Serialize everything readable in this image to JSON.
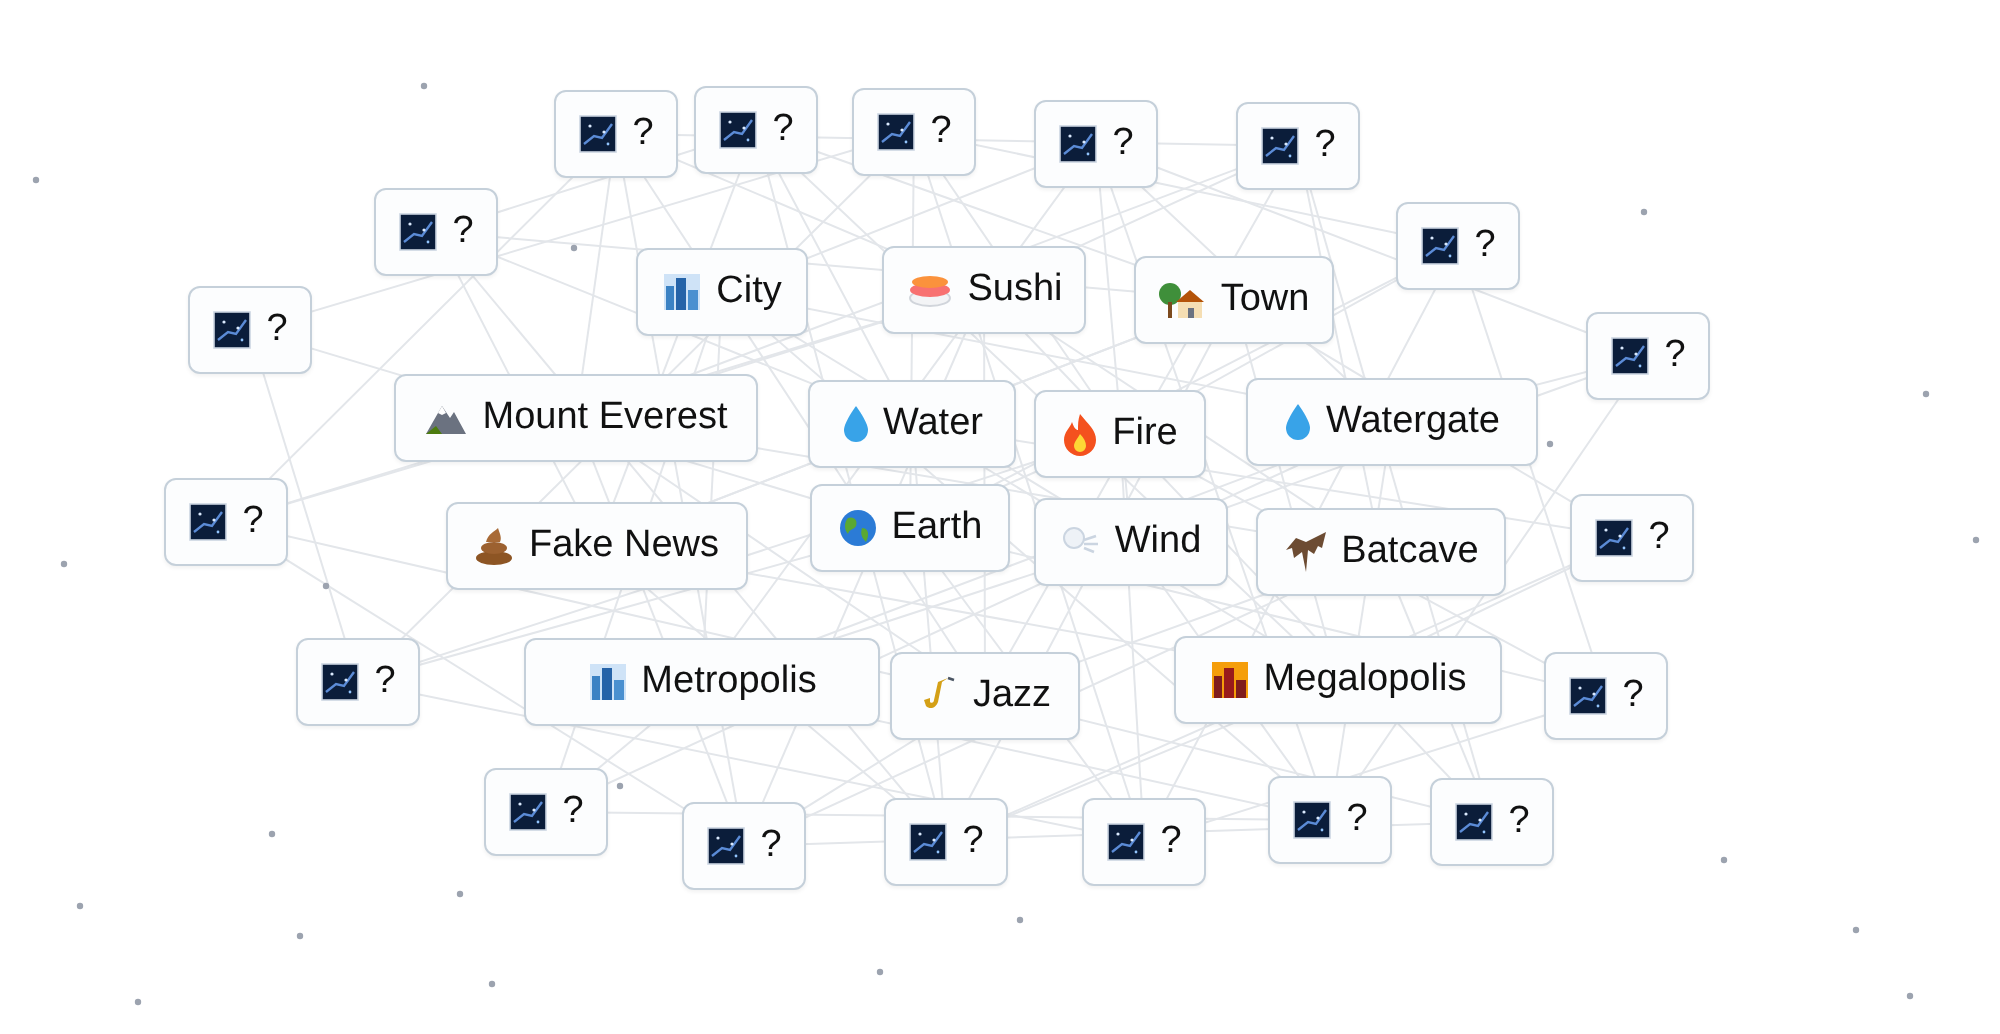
{
  "nodes": [
    {
      "kind": "unknown",
      "label": "?"
    },
    {
      "kind": "unknown",
      "label": "?"
    },
    {
      "kind": "unknown",
      "label": "?"
    },
    {
      "kind": "unknown",
      "label": "?"
    },
    {
      "kind": "unknown",
      "label": "?"
    },
    {
      "kind": "unknown",
      "label": "?"
    },
    {
      "kind": "unknown",
      "label": "?"
    },
    {
      "kind": "city",
      "label": "City"
    },
    {
      "kind": "sushi",
      "label": "Sushi"
    },
    {
      "kind": "town",
      "label": "Town"
    },
    {
      "kind": "unknown",
      "label": "?"
    },
    {
      "kind": "unknown",
      "label": "?"
    },
    {
      "kind": "mountain",
      "label": "Mount Everest"
    },
    {
      "kind": "droplet",
      "label": "Water"
    },
    {
      "kind": "fire",
      "label": "Fire"
    },
    {
      "kind": "droplet",
      "label": "Watergate"
    },
    {
      "kind": "unknown",
      "label": "?"
    },
    {
      "kind": "poop",
      "label": "Fake News"
    },
    {
      "kind": "globe",
      "label": "Earth"
    },
    {
      "kind": "wind",
      "label": "Wind"
    },
    {
      "kind": "bat",
      "label": "Batcave"
    },
    {
      "kind": "unknown",
      "label": "?"
    },
    {
      "kind": "unknown",
      "label": "?"
    },
    {
      "kind": "city",
      "label": "Metropolis"
    },
    {
      "kind": "saxophone",
      "label": "Jazz"
    },
    {
      "kind": "skyline",
      "label": "Megalopolis"
    },
    {
      "kind": "unknown",
      "label": "?"
    },
    {
      "kind": "unknown",
      "label": "?"
    },
    {
      "kind": "unknown",
      "label": "?"
    },
    {
      "kind": "unknown",
      "label": "?"
    },
    {
      "kind": "unknown",
      "label": "?"
    },
    {
      "kind": "unknown",
      "label": "?"
    },
    {
      "kind": "unknown",
      "label": "?"
    }
  ]
}
